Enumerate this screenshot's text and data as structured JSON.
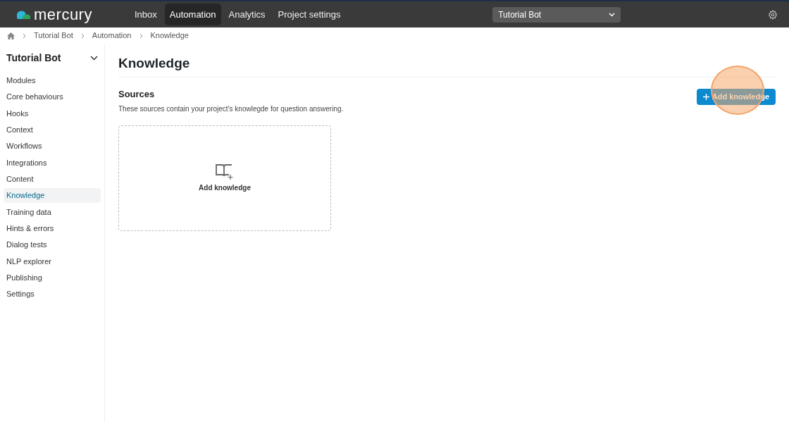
{
  "topbar": {
    "logo_text": "mercury",
    "nav": [
      {
        "label": "Inbox",
        "selected": false
      },
      {
        "label": "Automation",
        "selected": true
      },
      {
        "label": "Analytics",
        "selected": false
      },
      {
        "label": "Project settings",
        "selected": false
      }
    ],
    "project_select": "Tutorial Bot"
  },
  "breadcrumb": [
    "Tutorial Bot",
    "Automation",
    "Knowledge"
  ],
  "sidebar": {
    "title": "Tutorial Bot",
    "items": [
      {
        "label": "Modules",
        "selected": false
      },
      {
        "label": "Core behaviours",
        "selected": false
      },
      {
        "label": "Hooks",
        "selected": false
      },
      {
        "label": "Context",
        "selected": false
      },
      {
        "label": "Workflows",
        "selected": false
      },
      {
        "label": "Integrations",
        "selected": false
      },
      {
        "label": "Content",
        "selected": false
      },
      {
        "label": "Knowledge",
        "selected": true
      },
      {
        "label": "Training data",
        "selected": false
      },
      {
        "label": "Hints & errors",
        "selected": false
      },
      {
        "label": "Dialog tests",
        "selected": false
      },
      {
        "label": "NLP explorer",
        "selected": false
      },
      {
        "label": "Publishing",
        "selected": false
      },
      {
        "label": "Settings",
        "selected": false
      }
    ]
  },
  "page": {
    "title": "Knowledge",
    "section_title": "Sources",
    "section_description": "These sources contain your project's knowlegde for question answering.",
    "add_button": "Add knowledge",
    "empty_card_label": "Add knowledge",
    "click_highlight": true
  }
}
